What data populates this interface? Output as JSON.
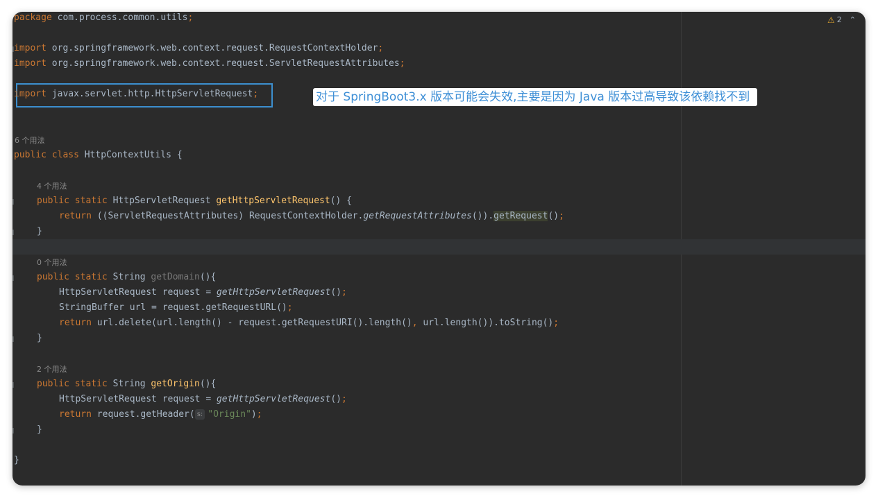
{
  "editor": {
    "warning_count": "2",
    "annotation": "对于 SpringBoot3.x 版本可能会失效,主要是因为 Java 版本过高导致该依赖找不到",
    "param_hint": "s:",
    "code": {
      "package_kw": "package",
      "package_name": " com.process.common.utils",
      "semicolon": ";",
      "import_kw": "import",
      "import1": " org.springframework.web.context.request.RequestContextHolder",
      "import2": " org.springframework.web.context.request.ServletRequestAttributes",
      "import3": " javax.servlet.http.HttpServletRequest",
      "usage_class": "6 个用法",
      "public_kw": "public",
      "class_kw": "class",
      "class_name": " HttpContextUtils {",
      "usage_m1": "4 个用法",
      "static_kw": "static",
      "m1_type": " HttpServletRequest ",
      "m1_name": "getHttpServletRequest",
      "m1_params": "() {",
      "return_kw": "return",
      "m1_body_a": " ((ServletRequestAttributes) RequestContextHolder.",
      "m1_body_b": "getRequestAttributes",
      "m1_body_c": "()).",
      "m1_body_d": "getRequest",
      "m1_body_e": "()",
      "close_brace": "}",
      "usage_m2": "0 个用法",
      "string_type": " String ",
      "m2_name": "getDomain",
      "m2_params": "(){",
      "m2_l1_a": "HttpServletRequest request = ",
      "m2_l1_b": "getHttpServletRequest",
      "m2_l1_c": "()",
      "m2_l2": "StringBuffer url = request.getRequestURL()",
      "m2_l3_a": " url.delete(url.length() - request.getRequestURI().length()",
      "comma": ",",
      "m2_l3_b": " url.length()).toString()",
      "usage_m3": "2 个用法",
      "m3_name": "getOrigin",
      "m3_params": "(){",
      "m3_l2_a": " request.getHeader(",
      "m3_l2_str": "\"Origin\"",
      "m3_l2_c": ")"
    }
  }
}
